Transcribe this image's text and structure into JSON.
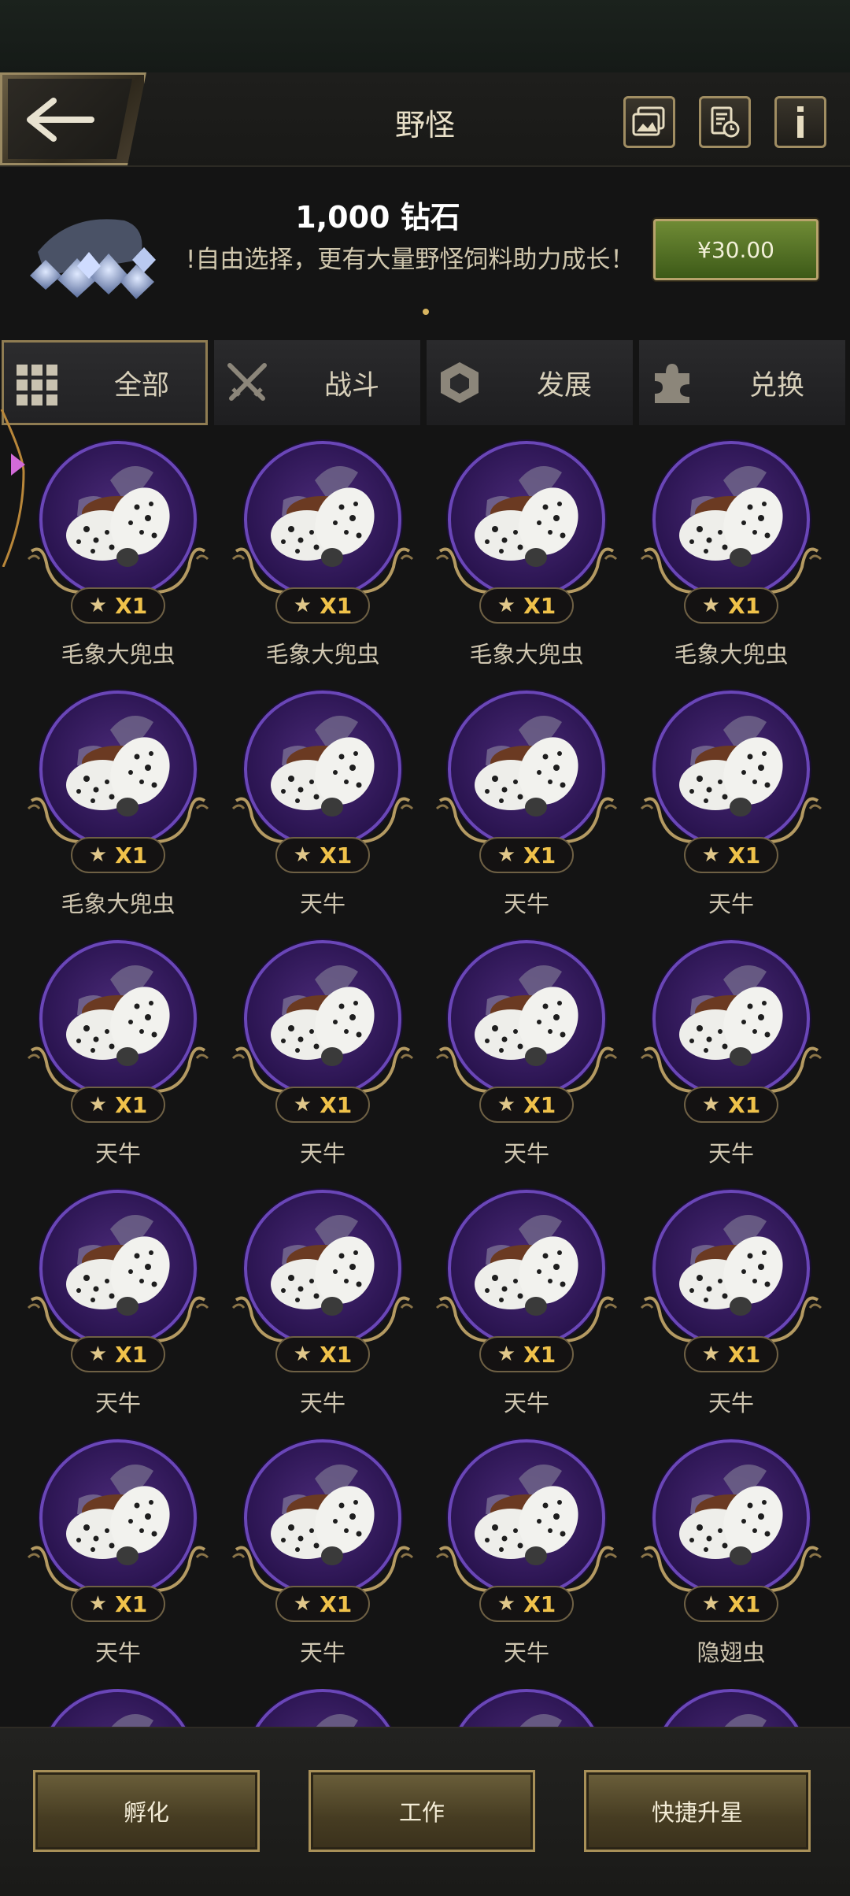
{
  "header": {
    "title": "野怪"
  },
  "banner": {
    "title": "1,000 钻石",
    "description": "!自由选择，更有大量野怪饲料助力成长！",
    "price": "¥30.00"
  },
  "tabs": [
    {
      "label": "全部",
      "icon": "grid-icon",
      "active": true
    },
    {
      "label": "战斗",
      "icon": "crossed-swords-icon",
      "active": false
    },
    {
      "label": "发展",
      "icon": "hexagon-icon",
      "active": false
    },
    {
      "label": "兑换",
      "icon": "puzzle-icon",
      "active": false
    }
  ],
  "monsters": [
    {
      "name": "毛象大兜虫",
      "count": "X1"
    },
    {
      "name": "毛象大兜虫",
      "count": "X1"
    },
    {
      "name": "毛象大兜虫",
      "count": "X1"
    },
    {
      "name": "毛象大兜虫",
      "count": "X1"
    },
    {
      "name": "毛象大兜虫",
      "count": "X1"
    },
    {
      "name": "天牛",
      "count": "X1"
    },
    {
      "name": "天牛",
      "count": "X1"
    },
    {
      "name": "天牛",
      "count": "X1"
    },
    {
      "name": "天牛",
      "count": "X1"
    },
    {
      "name": "天牛",
      "count": "X1"
    },
    {
      "name": "天牛",
      "count": "X1"
    },
    {
      "name": "天牛",
      "count": "X1"
    },
    {
      "name": "天牛",
      "count": "X1"
    },
    {
      "name": "天牛",
      "count": "X1"
    },
    {
      "name": "天牛",
      "count": "X1"
    },
    {
      "name": "天牛",
      "count": "X1"
    },
    {
      "name": "天牛",
      "count": "X1"
    },
    {
      "name": "天牛",
      "count": "X1"
    },
    {
      "name": "天牛",
      "count": "X1"
    },
    {
      "name": "隐翅虫",
      "count": "X1"
    }
  ],
  "footer": {
    "hatch_label": "孵化",
    "work_label": "工作",
    "quick_star_label": "快捷升星"
  },
  "colors": {
    "accent_gold": "#a89058",
    "disc_purple": "#6a46b8",
    "price_green": "#5a7a28"
  }
}
